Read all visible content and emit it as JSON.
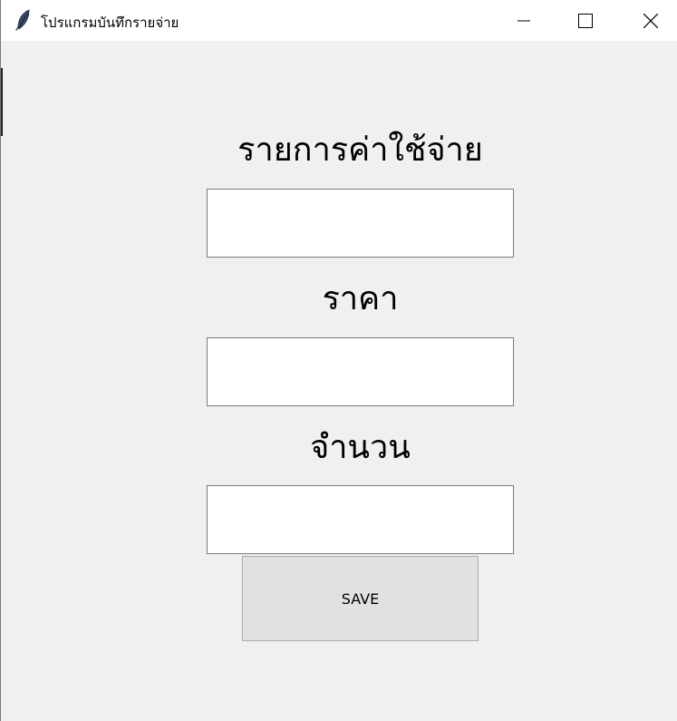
{
  "window": {
    "title": "โปรแกรมบันทึกรายจ่าย",
    "app_icon": "feather-icon",
    "controls": {
      "minimize_icon": "minimize-icon",
      "maximize_icon": "maximize-icon",
      "close_icon": "close-icon"
    }
  },
  "form": {
    "item_label": "รายการค่าใช้จ่าย",
    "item_value": "",
    "price_label": "ราคา",
    "price_value": "",
    "quantity_label": "จำนวน",
    "quantity_value": "",
    "save_label": "SAVE"
  },
  "colors": {
    "background": "#f0f0f0",
    "titlebar": "#ffffff",
    "button": "#e1e1e1"
  }
}
